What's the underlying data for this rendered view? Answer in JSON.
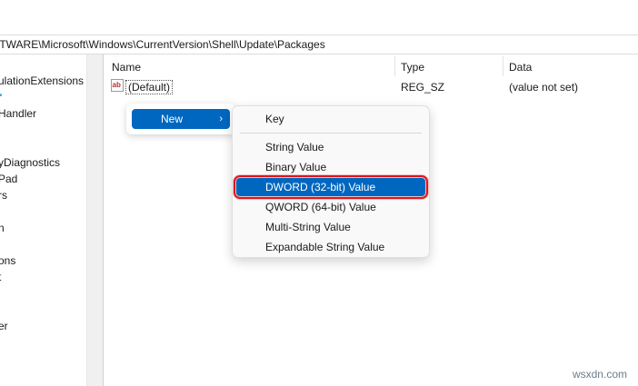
{
  "address": {
    "path": "FTWARE\\Microsoft\\Windows\\CurrentVersion\\Shell\\Update\\Packages"
  },
  "tree": {
    "items": [
      "ulationExtensions",
      "•",
      "Handler",
      "yDiagnostics",
      "Pad",
      "rs",
      "n",
      "ons",
      "t",
      "er"
    ]
  },
  "list": {
    "columns": {
      "name": "Name",
      "type": "Type",
      "data": "Data"
    },
    "rows": [
      {
        "icon": "string-value-icon",
        "icon_text": "ab",
        "name": "(Default)",
        "type": "REG_SZ",
        "data": "(value not set)"
      }
    ]
  },
  "context_menu": {
    "new_label": "New",
    "new_arrow": "›",
    "submenu": [
      "Key",
      "String Value",
      "Binary Value",
      "DWORD (32-bit) Value",
      "QWORD (64-bit) Value",
      "Multi-String Value",
      "Expandable String Value"
    ],
    "highlighted": "DWORD (32-bit) Value"
  },
  "colors": {
    "accent": "#0067c0",
    "highlight_outline": "#e0161b",
    "tree_dot": "#2ba8d8"
  },
  "watermark": "wsxdn.com"
}
